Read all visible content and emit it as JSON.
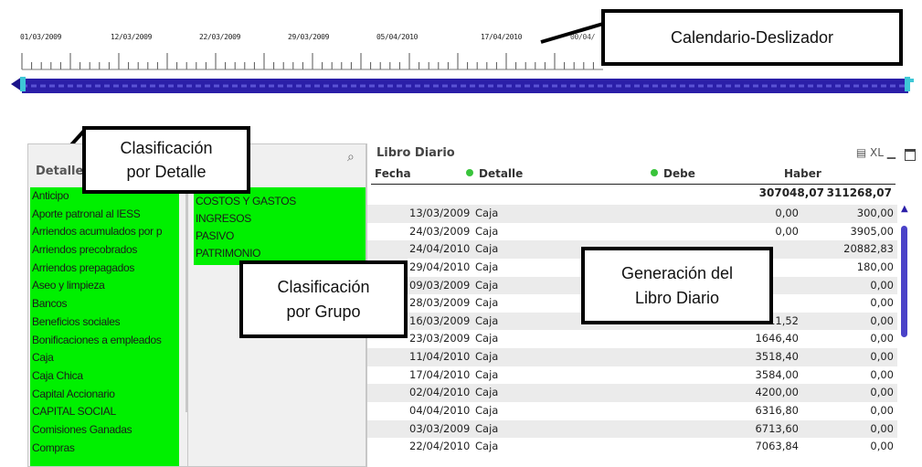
{
  "slider": {
    "dates": [
      "01/03/2009",
      "12/03/2009",
      "22/03/2009",
      "29/03/2009",
      "05/04/2010",
      "17/04/2010"
    ],
    "track_color": "#2b1fa8",
    "handle_color": "#3ec7d6"
  },
  "callouts": {
    "calendario": "Calendario-Deslizador",
    "detalle": "Clasificación\npor Detalle",
    "grupo": "Clasificación\npor Grupo",
    "libro": "Generación del\nLibro Diario"
  },
  "detalle_box": {
    "title": "Detalle",
    "items": [
      "Anticipo",
      "Aporte patronal al IESS",
      "Arriendos acumulados por p",
      "Arriendos precobrados",
      "Arriendos prepagados",
      "Aseo y limpieza",
      "Bancos",
      "Beneficios sociales",
      "Bonificaciones a empleados",
      "Caja",
      "Caja Chica",
      "Capital Accionario",
      "CAPITAL SOCIAL",
      "Comisiones Ganadas",
      "Compras"
    ]
  },
  "grupo_box": {
    "items": [
      "COSTOS Y GASTOS",
      "INGRESOS",
      "PASIVO",
      "PATRIMONIO"
    ]
  },
  "libro": {
    "title": "Libro Diario",
    "headers": {
      "fecha": "Fecha",
      "detalle": "Detalle",
      "debe": "Debe",
      "haber": "Haber"
    },
    "totals": {
      "debe": "307048,07",
      "haber": "311268,07"
    },
    "toolbar_xl": "XL",
    "rows": [
      {
        "fecha": "13/03/2009",
        "detalle": "Caja",
        "debe": "0,00",
        "haber": "300,00"
      },
      {
        "fecha": "24/03/2009",
        "detalle": "Caja",
        "debe": "0,00",
        "haber": "3905,00"
      },
      {
        "fecha": "24/04/2010",
        "detalle": "Caja",
        "debe": "",
        "haber": "20882,83"
      },
      {
        "fecha": "29/04/2010",
        "detalle": "Caja",
        "debe": "",
        "haber": "180,00"
      },
      {
        "fecha": "09/03/2009",
        "detalle": "Caja",
        "debe": "",
        "haber": "0,00"
      },
      {
        "fecha": "28/03/2009",
        "detalle": "Caja",
        "debe": "",
        "haber": "0,00"
      },
      {
        "fecha": "16/03/2009",
        "detalle": "Caja",
        "debe": "611,52",
        "haber": "0,00"
      },
      {
        "fecha": "23/03/2009",
        "detalle": "Caja",
        "debe": "1646,40",
        "haber": "0,00"
      },
      {
        "fecha": "11/04/2010",
        "detalle": "Caja",
        "debe": "3518,40",
        "haber": "0,00"
      },
      {
        "fecha": "17/04/2010",
        "detalle": "Caja",
        "debe": "3584,00",
        "haber": "0,00"
      },
      {
        "fecha": "02/04/2010",
        "detalle": "Caja",
        "debe": "4200,00",
        "haber": "0,00"
      },
      {
        "fecha": "04/04/2010",
        "detalle": "Caja",
        "debe": "6316,80",
        "haber": "0,00"
      },
      {
        "fecha": "03/03/2009",
        "detalle": "Caja",
        "debe": "6713,60",
        "haber": "0,00"
      },
      {
        "fecha": "22/04/2010",
        "detalle": "Caja",
        "debe": "7063,84",
        "haber": "0,00"
      }
    ]
  }
}
